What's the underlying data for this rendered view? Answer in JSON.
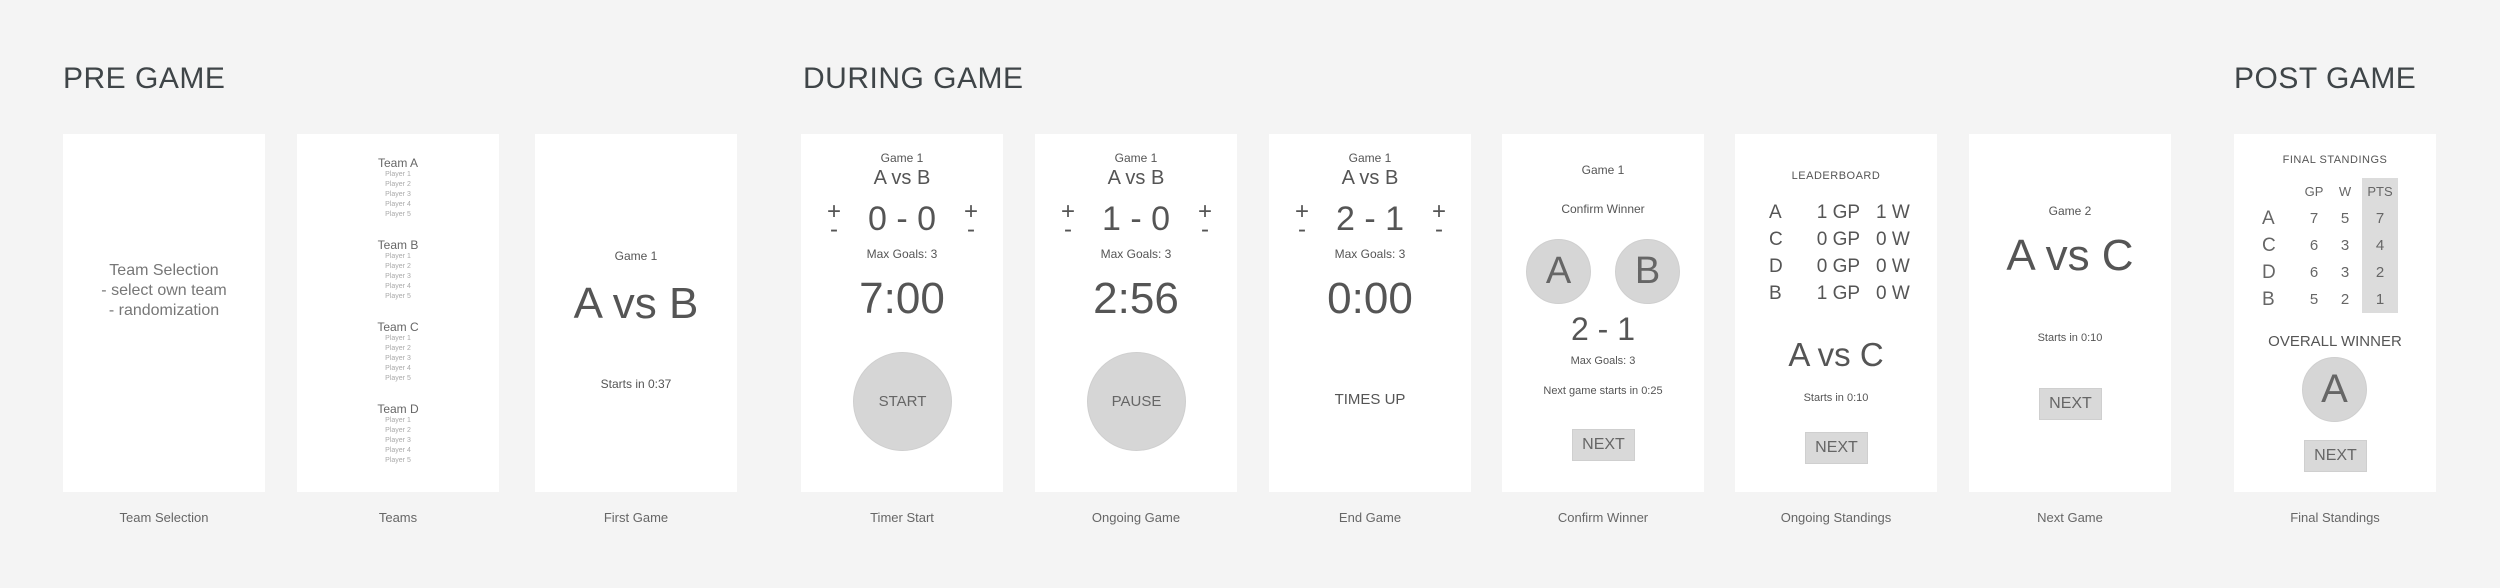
{
  "sections": {
    "pre_game": "PRE GAME",
    "during_game": "DURING GAME",
    "post_game": "POST GAME"
  },
  "team_selection": {
    "caption": "Team Selection",
    "lines": [
      "Team Selection",
      "- select own team",
      "- randomization"
    ]
  },
  "teams": {
    "caption": "Teams",
    "list": [
      {
        "name": "Team A",
        "players": [
          "Player 1",
          "Player 2",
          "Player 3",
          "Player 4",
          "Player 5"
        ]
      },
      {
        "name": "Team B",
        "players": [
          "Player 1",
          "Player 2",
          "Player 3",
          "Player 4",
          "Player 5"
        ]
      },
      {
        "name": "Team C",
        "players": [
          "Player 1",
          "Player 2",
          "Player 3",
          "Player 4",
          "Player 5"
        ]
      },
      {
        "name": "Team D",
        "players": [
          "Player 1",
          "Player 2",
          "Player 3",
          "Player 4",
          "Player 5"
        ]
      }
    ]
  },
  "first_game": {
    "caption": "First Game",
    "game": "Game 1",
    "matchup": "A vs B",
    "starts": "Starts in 0:37"
  },
  "timer_start": {
    "caption": "Timer Start",
    "game": "Game 1",
    "matchup": "A vs B",
    "score": "0 - 0",
    "max_goals": "Max Goals: 3",
    "timer": "7:00",
    "button": "START",
    "plus": "+",
    "minus": "-"
  },
  "ongoing_game": {
    "caption": "Ongoing Game",
    "game": "Game 1",
    "matchup": "A vs B",
    "score": "1 - 0",
    "max_goals": "Max Goals: 3",
    "timer": "2:56",
    "button": "PAUSE",
    "plus": "+",
    "minus": "-"
  },
  "end_game": {
    "caption": "End Game",
    "game": "Game 1",
    "matchup": "A vs B",
    "score": "2 - 1",
    "max_goals": "Max Goals: 3",
    "timer": "0:00",
    "status": "TIMES UP",
    "plus": "+",
    "minus": "-"
  },
  "confirm_winner": {
    "caption": "Confirm Winner",
    "game": "Game 1",
    "prompt": "Confirm Winner",
    "team_a": "A",
    "team_b": "B",
    "score": "2 - 1",
    "max_goals": "Max Goals: 3",
    "next_game": "Next game starts in 0:25",
    "button": "NEXT"
  },
  "ongoing_standings": {
    "caption": "Ongoing Standings",
    "title": "LEADERBOARD",
    "rows": [
      {
        "team": "A",
        "gp": "1 GP",
        "w": "1 W"
      },
      {
        "team": "C",
        "gp": "0 GP",
        "w": "0 W"
      },
      {
        "team": "D",
        "gp": "0 GP",
        "w": "0 W"
      },
      {
        "team": "B",
        "gp": "1 GP",
        "w": "0 W"
      }
    ],
    "matchup": "A vs C",
    "starts": "Starts in 0:10",
    "button": "NEXT"
  },
  "next_game": {
    "caption": "Next Game",
    "game": "Game 2",
    "matchup": "A vs C",
    "starts": "Starts in 0:10",
    "button": "NEXT"
  },
  "final_standings": {
    "caption": "Final Standings",
    "title": "FINAL STANDINGS",
    "headers": [
      "",
      "GP",
      "W",
      "PTS"
    ],
    "rows": [
      {
        "team": "A",
        "gp": "7",
        "w": "5",
        "pts": "7"
      },
      {
        "team": "C",
        "gp": "6",
        "w": "3",
        "pts": "4"
      },
      {
        "team": "D",
        "gp": "6",
        "w": "3",
        "pts": "2"
      },
      {
        "team": "B",
        "gp": "5",
        "w": "2",
        "pts": "1"
      }
    ],
    "overall_label": "OVERALL WINNER",
    "winner": "A",
    "button": "NEXT"
  }
}
